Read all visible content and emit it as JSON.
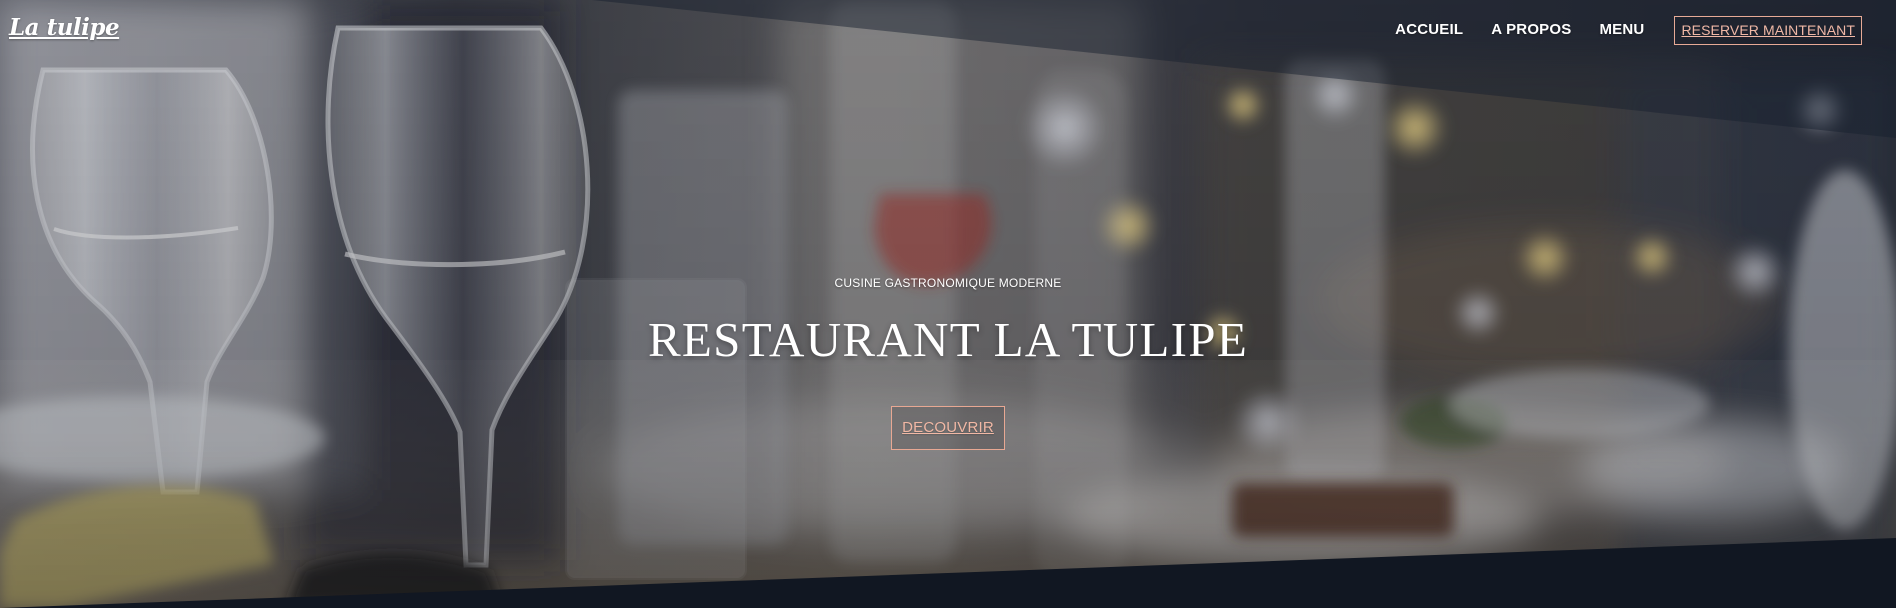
{
  "header": {
    "logo": "La tulipe",
    "nav": [
      {
        "label": "ACCUEIL"
      },
      {
        "label": "A PROPOS"
      },
      {
        "label": "MENU"
      }
    ],
    "cta": "RESERVER MAINTENANT"
  },
  "hero": {
    "tagline": "CUSINE GASTRONOMIQUE MODERNE",
    "title": "RESTAURANT LA TULIPE",
    "button": "DECOUVRIR"
  },
  "colors": {
    "accent": "#e8a893",
    "dark": "#111722",
    "text": "#ffffff"
  }
}
